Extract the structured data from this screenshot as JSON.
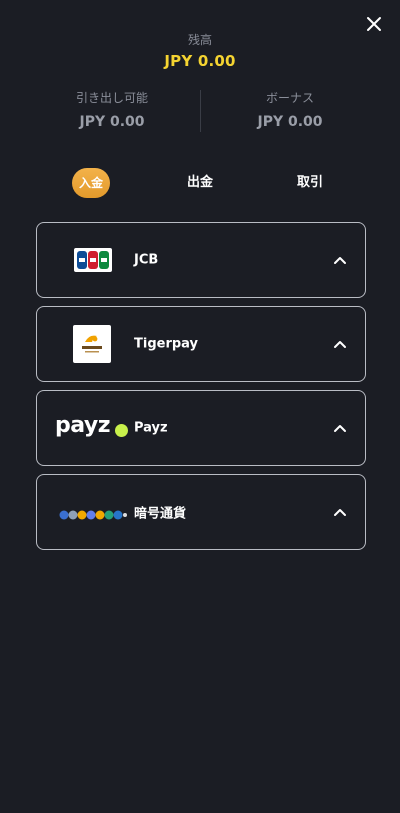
{
  "balance": {
    "label": "残高",
    "value": "JPY 0.00"
  },
  "withdrawable": {
    "label": "引き出し可能",
    "value": "JPY 0.00"
  },
  "bonus": {
    "label": "ボーナス",
    "value": "JPY 0.00"
  },
  "tabs": [
    {
      "label": "入金",
      "active": true
    },
    {
      "label": "出金",
      "active": false
    },
    {
      "label": "取引",
      "active": false
    }
  ],
  "methods": [
    {
      "name": "JCB",
      "icon": "jcb-logo"
    },
    {
      "name": "Tigerpay",
      "icon": "tigerpay-logo"
    },
    {
      "name": "Payz",
      "icon": "payz-logo",
      "logo_text": "payz"
    },
    {
      "name": "暗号通貨",
      "icon": "crypto-coins-logo"
    }
  ],
  "colors": {
    "background": "#1b1d24",
    "balance_value": "#f5d431",
    "active_tab": "#e9a43a",
    "payz_dot": "#c8f04b",
    "card_border": "#b9bcc4"
  }
}
